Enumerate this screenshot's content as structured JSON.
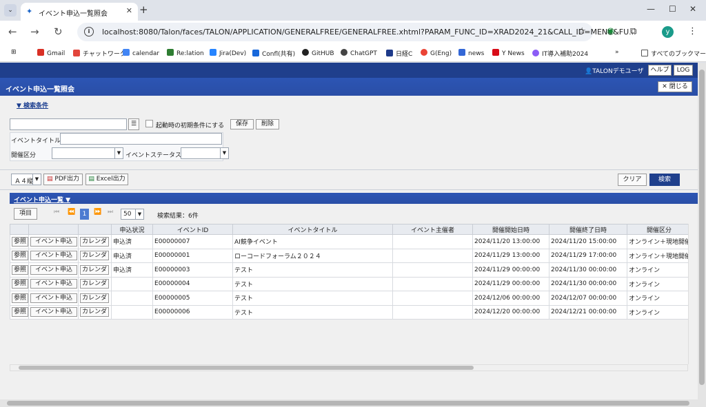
{
  "browser": {
    "tab_title": "イベント申込一覧照会",
    "url": "localhost:8080/Talon/faces/TALON/APPLICATION/GENERALFREE/GENERALFREE.xhtml?PARAM_FUNC_ID=XRAD2024_21&CALL_ID=MENU&FU...",
    "avatar_letter": "y",
    "bookmarks": [
      "Gmail",
      "チャットワーク",
      "calendar",
      "Re:lation",
      "Jira(Dev)",
      "Confl(共有)",
      "GitHUB",
      "ChatGPT",
      "日経C",
      "G(Eng)",
      "news",
      "Y News",
      "IT導入補助2024"
    ],
    "all_bookmarks": "すべてのブックマーク"
  },
  "header": {
    "user": "TALONデモユーザ",
    "help": "ヘルプ",
    "log": "LOG",
    "page_title": "イベント申込一覧照会",
    "close": "閉じる"
  },
  "search": {
    "section_label": "▼ 検索条件",
    "startup_checkbox_label": "起動時の初期条件にする",
    "save": "保存",
    "delete": "削除",
    "event_title_label": "イベントタイトル",
    "category_label": "開催区分",
    "status_label": "イベントステータス"
  },
  "actions": {
    "paper_size": "Ａ４縦",
    "pdf": "PDF出力",
    "excel": "Excel出力",
    "clear": "クリア",
    "search": "検索"
  },
  "list": {
    "section_label": "イベント申込一覧 ▼",
    "columns_button": "項目",
    "page": "1",
    "page_size": "50",
    "result_count": "検索結果：6件",
    "headers": [
      "",
      "",
      "",
      "申込状況",
      "イベントID",
      "イベントタイトル",
      "イベント主催者",
      "開催開始日時",
      "開催終了日時",
      "開催区分"
    ],
    "row_buttons": {
      "ref": "参照",
      "apply": "イベント申込",
      "calendar": "カレンダ"
    },
    "rows": [
      {
        "status": "申込済",
        "id": "E00000007",
        "title": "AI競争イベント",
        "organizer": "",
        "start": "2024/11/20 13:00:00",
        "end": "2024/11/20 15:00:00",
        "category": "オンライン＋現地開催"
      },
      {
        "status": "申込済",
        "id": "E00000001",
        "title": "ローコードフォーラム２０２４",
        "organizer": "",
        "start": "2024/11/29 13:00:00",
        "end": "2024/11/29 17:00:00",
        "category": "オンライン＋現地開催"
      },
      {
        "status": "申込済",
        "id": "E00000003",
        "title": "テスト",
        "organizer": "",
        "start": "2024/11/29 00:00:00",
        "end": "2024/11/30 00:00:00",
        "category": "オンライン"
      },
      {
        "status": "",
        "id": "E00000004",
        "title": "テスト",
        "organizer": "",
        "start": "2024/11/29 00:00:00",
        "end": "2024/11/30 00:00:00",
        "category": "オンライン"
      },
      {
        "status": "",
        "id": "E00000005",
        "title": "テスト",
        "organizer": "",
        "start": "2024/12/06 00:00:00",
        "end": "2024/12/07 00:00:00",
        "category": "オンライン"
      },
      {
        "status": "",
        "id": "E00000006",
        "title": "テスト",
        "organizer": "",
        "start": "2024/12/20 00:00:00",
        "end": "2024/12/21 00:00:00",
        "category": "オンライン"
      }
    ]
  }
}
